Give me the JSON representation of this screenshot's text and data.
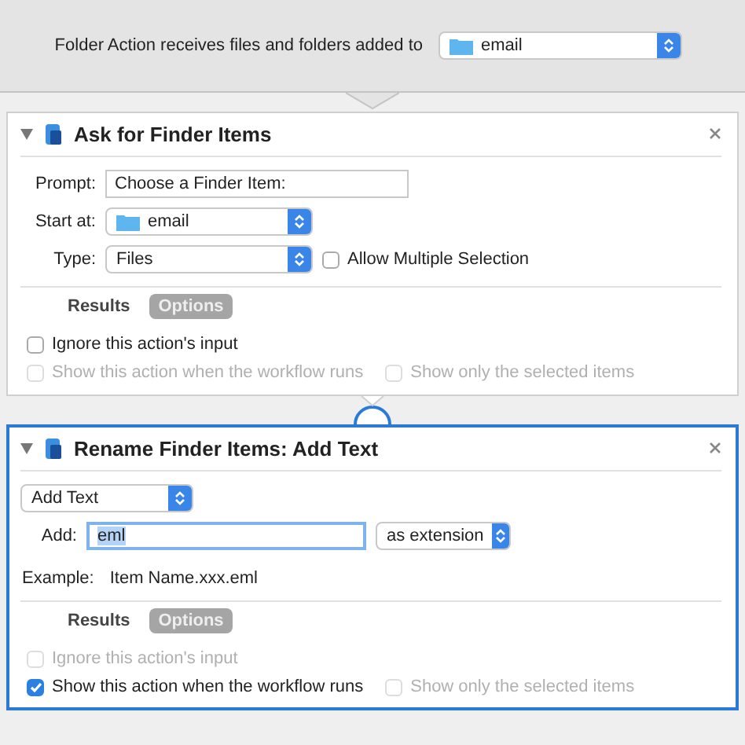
{
  "header": {
    "label": "Folder Action receives files and folders added to",
    "folder_popup": {
      "value": "email"
    }
  },
  "actions": [
    {
      "title": "Ask for Finder Items",
      "expanded": true,
      "selected": false,
      "rows": [
        {
          "items": [
            {
              "kind": "label",
              "text": "Prompt:"
            },
            {
              "kind": "text_field",
              "value": "Choose a Finder Item:",
              "focused": false
            }
          ]
        },
        {
          "items": [
            {
              "kind": "label",
              "text": "Start at:"
            },
            {
              "kind": "popup",
              "value": "email",
              "folder": true
            }
          ]
        },
        {
          "items": [
            {
              "kind": "label",
              "text": "Type:"
            },
            {
              "kind": "popup",
              "value": "Files",
              "folder": false
            },
            {
              "kind": "checkbox",
              "label": "Allow Multiple Selection",
              "checked": false,
              "disabled": false
            }
          ]
        }
      ],
      "tabs": [
        {
          "label": "Results",
          "selected": false
        },
        {
          "label": "Options",
          "selected": true
        }
      ],
      "options": [
        {
          "items": [
            {
              "label": "Ignore this action's input",
              "checked": false,
              "disabled": false
            }
          ]
        },
        {
          "items": [
            {
              "label": "Show this action when the workflow runs",
              "checked": false,
              "disabled": true
            },
            {
              "label": "Show only the selected items",
              "checked": false,
              "disabled": true
            }
          ]
        }
      ]
    },
    {
      "title": "Rename Finder Items: Add Text",
      "expanded": true,
      "selected": true,
      "rows": [
        {
          "items": [
            {
              "kind": "popup",
              "value": "Add Text",
              "folder": false
            }
          ]
        },
        {
          "items": [
            {
              "kind": "label",
              "text": "Add:"
            },
            {
              "kind": "text_field",
              "value": "eml",
              "focused": true
            },
            {
              "kind": "popup",
              "value": "as extension",
              "folder": false
            }
          ]
        },
        {
          "items": [
            {
              "kind": "info_label",
              "text": "Example:"
            },
            {
              "kind": "info",
              "text": "Item Name.xxx.eml"
            }
          ]
        }
      ],
      "tabs": [
        {
          "label": "Results",
          "selected": false
        },
        {
          "label": "Options",
          "selected": true
        }
      ],
      "options": [
        {
          "items": [
            {
              "label": "Ignore this action's input",
              "checked": false,
              "disabled": true
            }
          ]
        },
        {
          "items": [
            {
              "label": "Show this action when the workflow runs",
              "checked": true,
              "disabled": false
            },
            {
              "label": "Show only the selected items",
              "checked": false,
              "disabled": true
            }
          ]
        }
      ]
    }
  ]
}
